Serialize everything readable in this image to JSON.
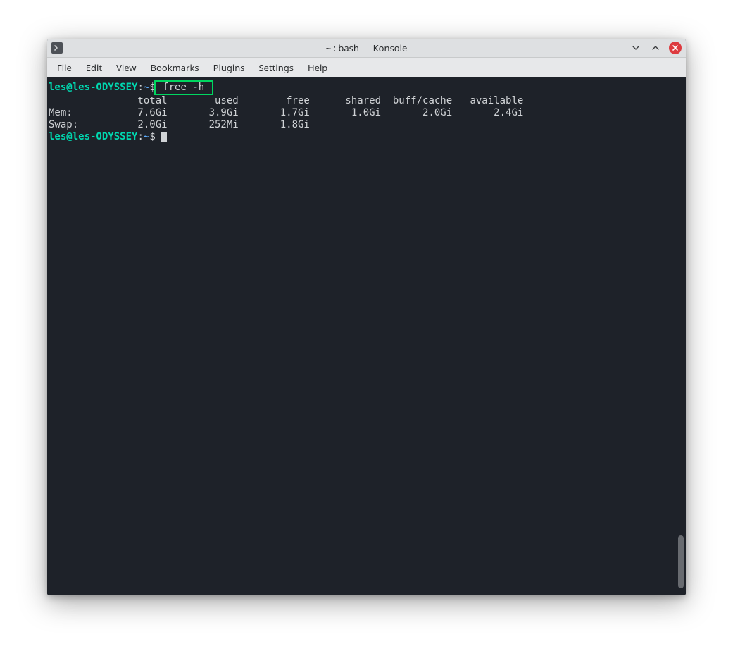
{
  "window": {
    "title": "~ : bash — Konsole"
  },
  "menubar": {
    "items": [
      "File",
      "Edit",
      "View",
      "Bookmarks",
      "Plugins",
      "Settings",
      "Help"
    ]
  },
  "terminal": {
    "prompt_user_host": "les@les-ODYSSEY",
    "prompt_sep1": ":",
    "prompt_path": "~",
    "prompt_dollar": "$",
    "command": " free -h ",
    "header": "               total        used        free      shared  buff/cache   available",
    "mem_line": "Mem:           7.6Gi       3.9Gi       1.7Gi       1.0Gi       2.0Gi       2.4Gi",
    "swap_line": "Swap:          2.0Gi       252Mi       1.8Gi"
  }
}
